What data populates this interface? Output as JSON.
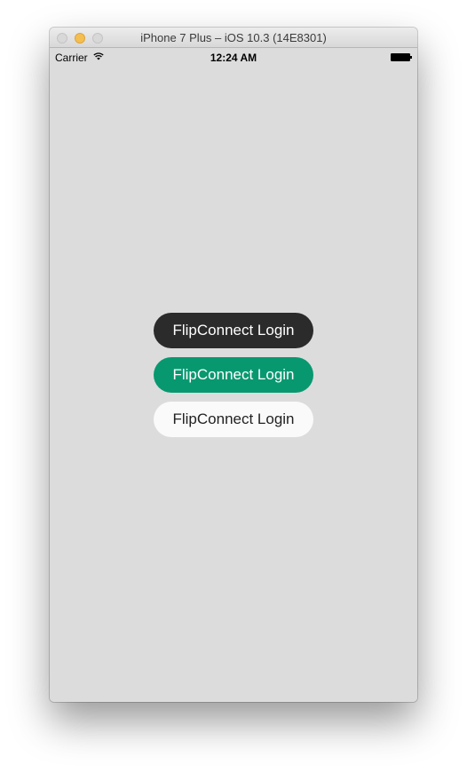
{
  "window": {
    "title": "iPhone 7 Plus – iOS 10.3 (14E8301)"
  },
  "status_bar": {
    "carrier": "Carrier",
    "time": "12:24 AM",
    "wifi_icon": "wifi-icon",
    "battery_icon": "battery-icon"
  },
  "buttons": [
    {
      "label": "FlipConnect Login",
      "style": "dark",
      "color": "#2b2b2b"
    },
    {
      "label": "FlipConnect Login",
      "style": "green",
      "color": "#089870"
    },
    {
      "label": "FlipConnect Login",
      "style": "light",
      "color": "#fafafa"
    }
  ],
  "colors": {
    "screen_background": "#dcdcdc",
    "accent_green": "#089870"
  }
}
